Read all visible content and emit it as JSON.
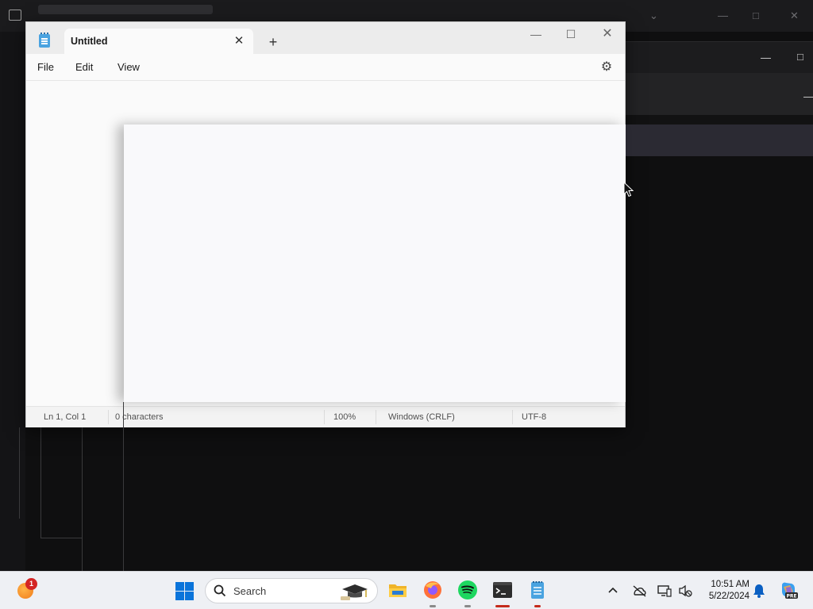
{
  "background": {
    "top_window_glyphs": [
      "—",
      "□",
      "✕",
      "⌄"
    ]
  },
  "notepad": {
    "tab_title": "Untitled",
    "tab_close_icon": "✕",
    "new_tab_icon": "+",
    "window_controls": {
      "minimize": "—",
      "maximize": "☐",
      "close": "✕"
    },
    "menu": {
      "file": "File",
      "edit": "Edit",
      "view": "View"
    },
    "settings_icon": "⚙",
    "status": {
      "position": "Ln 1, Col 1",
      "characters": "0 characters",
      "zoom": "100%",
      "line_ending": "Windows (CRLF)",
      "encoding": "UTF-8"
    }
  },
  "browser": {
    "new_tab_icon": "+",
    "list_tabs_icon": "⌄"
  },
  "taskbar": {
    "widget_badge": "1",
    "search_placeholder": "Search",
    "apps": [
      "file-explorer",
      "firefox",
      "spotify",
      "terminal",
      "notepad"
    ],
    "tray_chevron": "^",
    "clock_time": "10:51 AM",
    "clock_date": "5/22/2024",
    "accent_color": "#0a74da",
    "active_indicator_color": "#c42b1c"
  }
}
